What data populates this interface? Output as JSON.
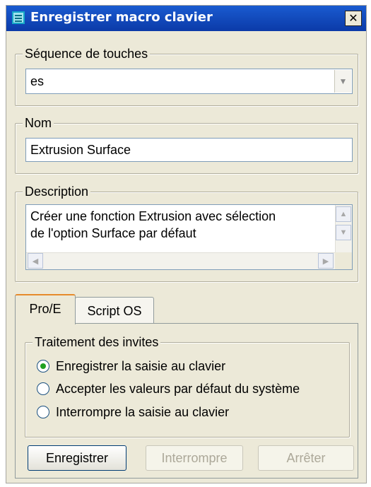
{
  "window": {
    "title": "Enregistrer macro clavier",
    "close_glyph": "✕"
  },
  "sequence": {
    "legend": "Séquence de touches",
    "value": "es",
    "arrow": "▼"
  },
  "name": {
    "legend": "Nom",
    "value": "Extrusion Surface"
  },
  "description": {
    "legend": "Description",
    "lines": [
      "Créer une fonction Extrusion avec sélection",
      "de l'option Surface par défaut"
    ],
    "scroll_up": "▲",
    "scroll_down": "▼",
    "scroll_left": "◀",
    "scroll_right": "▶"
  },
  "tabs": [
    {
      "label": "Pro/E",
      "active": true
    },
    {
      "label": "Script OS",
      "active": false
    }
  ],
  "prompts": {
    "legend": "Traitement des invites",
    "options": [
      {
        "label": "Enregistrer la saisie au clavier",
        "checked": true
      },
      {
        "label": "Accepter les valeurs par défaut du système",
        "checked": false
      },
      {
        "label": "Interrompre la saisie au clavier",
        "checked": false
      }
    ]
  },
  "buttons": {
    "record": "Enregistrer",
    "interrupt": "Interrompre",
    "stop": "Arrêter"
  }
}
